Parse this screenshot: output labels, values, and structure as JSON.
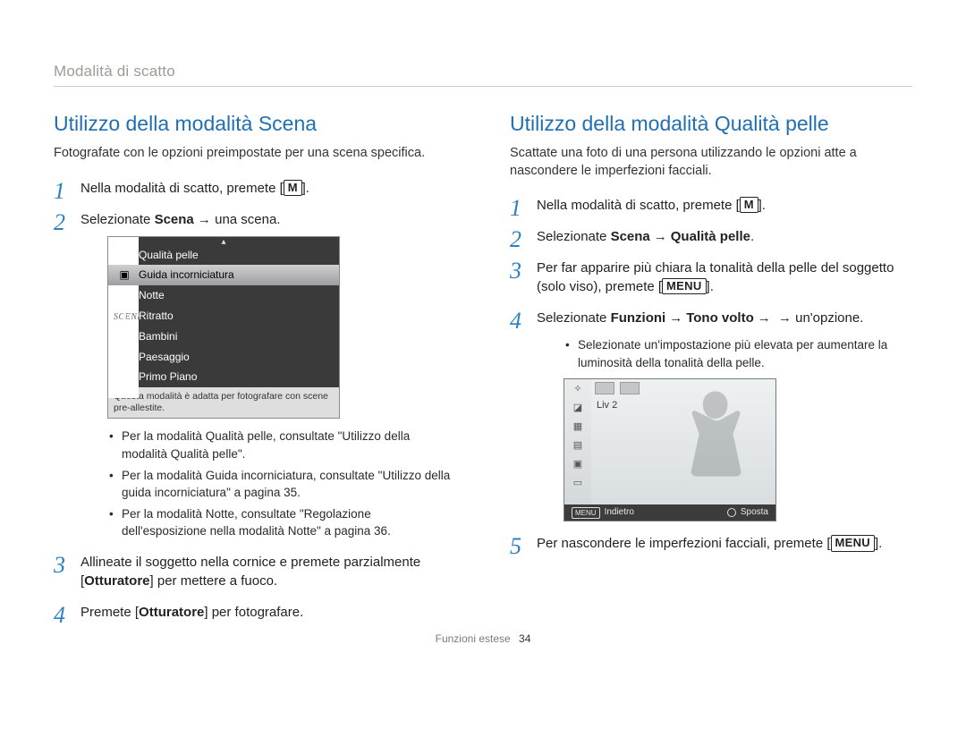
{
  "header": {
    "breadcrumb": "Modalità di scatto"
  },
  "footer": {
    "section": "Funzioni estese",
    "page": "34"
  },
  "keys": {
    "mode": "M",
    "menu": "MENU"
  },
  "left": {
    "title": "Utilizzo della modalità Scena",
    "subtitle": "Fotografate con le opzioni preimpostate per una scena specifica.",
    "steps": {
      "s1": "Nella modalità di scatto, premete [",
      "s1_end": "].",
      "s2_a": "Selezionate ",
      "s2_b": "Scena",
      "s2_c": " → una scena.",
      "s3_a": "Allineate il soggetto nella cornice e premete parzialmente [",
      "s3_key": "Otturatore",
      "s3_b": "] per mettere a fuoco.",
      "s4_a": "Premete [",
      "s4_key": "Otturatore",
      "s4_b": "] per fotografare."
    },
    "bullets": {
      "b1": "Per la modalità Qualità pelle, consultate \"Utilizzo della modalità Qualità pelle\".",
      "b2": "Per la modalità Guida incorniciatura, consultate \"Utilizzo della guida incorniciatura\" a pagina 35.",
      "b3": "Per la modalità Notte, consultate \"Regolazione dell'esposizione nella modalità Notte\" a pagina 36."
    },
    "scene_menu": {
      "side_label": "SCENE",
      "items": [
        "Qualità pelle",
        "Guida incorniciatura",
        "Notte",
        "Ritratto",
        "Bambini",
        "Paesaggio",
        "Primo Piano"
      ],
      "selected_index": 1,
      "description": "Questa modalità è adatta per fotografare con scene pre-allestite."
    }
  },
  "right": {
    "title": "Utilizzo della modalità Qualità pelle",
    "subtitle": "Scattate una foto di una persona utilizzando le opzioni atte a nascondere le imperfezioni facciali.",
    "steps": {
      "s1": "Nella modalità di scatto, premete [",
      "s1_end": "].",
      "s2_a": "Selezionate ",
      "s2_b": "Scena",
      "s2_c": " → ",
      "s2_d": "Qualità pelle",
      "s2_e": ".",
      "s3_a": "Per far apparire più chiara la tonalità della pelle del soggetto (solo viso), premete [",
      "s3_b": "].",
      "s4_a": "Selezionate ",
      "s4_b": "Funzioni",
      "s4_c": " → ",
      "s4_d": "Tono volto",
      "s4_e": " → un'opzione.",
      "s5_a": "Per nascondere le imperfezioni facciali, premete [",
      "s5_b": "]."
    },
    "bullets": {
      "b1": "Selezionate un'impostazione più elevata per aumentare la luminosità della tonalità della pelle."
    },
    "cam": {
      "liv_label": "Liv 2",
      "back": "Indietro",
      "move": "Sposta",
      "menu_key": "MENU"
    }
  }
}
